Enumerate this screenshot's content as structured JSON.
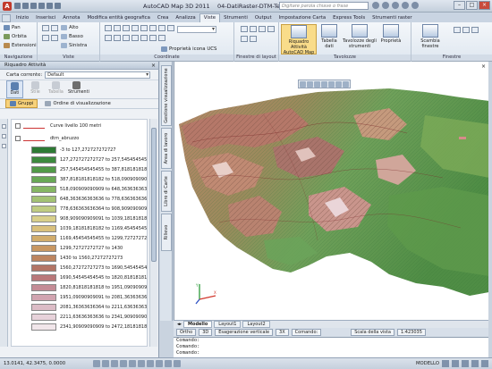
{
  "window": {
    "title": "AutoCAD Map 3D 2011",
    "document": "04-DatiRaster-DTM-Tema2-CurveLivello.dwg",
    "search_placeholder": "Digitare parola chiave o frase"
  },
  "ribbon_tabs": [
    "Inizio",
    "Inserisci",
    "Annota",
    "Modifica entità geografica",
    "Crea",
    "Analizza",
    "Viste",
    "Strumenti",
    "Output",
    "Impostazione Carta",
    "Express Tools",
    "Strumenti raster"
  ],
  "active_tab": "Viste",
  "ribbon": {
    "navigazione": {
      "title": "Navigazione",
      "items": [
        "Pan",
        "Orbita",
        "Estensioni"
      ]
    },
    "viste": {
      "title": "Viste",
      "items": [
        "Alto",
        "Basso",
        "Sinistra"
      ]
    },
    "coordinate": {
      "title": "Coordinate",
      "proprieta_ucs": "Proprietà icona UCS"
    },
    "finestre_layout": {
      "title": "Finestre di layout"
    },
    "tavolozze": {
      "title": "Tavolozze",
      "buttons": [
        "Riquadro Attività AutoCAD Map",
        "Tabella dati",
        "Tavolozze degli strumenti",
        "Proprietà"
      ]
    },
    "finestre": {
      "title": "Finestre",
      "buttons": [
        "Scambia finestre"
      ]
    }
  },
  "palette": {
    "title": "Riquadro Attività",
    "close": "×",
    "carta_label": "Carta corrente:",
    "carta_value": "Default",
    "modes": [
      "Dati",
      "Stile",
      "Tabella",
      "Strumenti"
    ],
    "subtabs": [
      "Gruppi",
      "Ordine di visualizzazione"
    ],
    "legend_rows": [
      {
        "label": "Curve livello 100 metri",
        "color": "#ffffff",
        "type": "layer"
      },
      {
        "label": "dtm_abruzzo",
        "color": "#ffffff",
        "type": "layer"
      },
      {
        "label": "-3 to 127,272727272727",
        "color": "#2e7a34"
      },
      {
        "label": "127,272727272727 to 257,545454545455",
        "color": "#3d8a3e"
      },
      {
        "label": "257,545454545455 to 387,818181818182",
        "color": "#529a48"
      },
      {
        "label": "387,818181818182 to 518,090909090909",
        "color": "#69a856"
      },
      {
        "label": "518,090909090909 to 648,363636363636",
        "color": "#86b664"
      },
      {
        "label": "648,363636363636 to 778,636363636364",
        "color": "#a3c274"
      },
      {
        "label": "778,636363636364 to 908,909090909091",
        "color": "#bfcc82"
      },
      {
        "label": "908,909090909091 to 1039,18181818182",
        "color": "#d8cf8b"
      },
      {
        "label": "1039,18181818182 to 1169,45454545455",
        "color": "#d9c07d"
      },
      {
        "label": "1169,45454545455 to 1299,72727272727",
        "color": "#d1ac6c"
      },
      {
        "label": "1299,72727272727 to 1430",
        "color": "#c89762"
      },
      {
        "label": "1430 to 1560,27272727273",
        "color": "#bd8560"
      },
      {
        "label": "1560,27272727273 to 1690,54545454545",
        "color": "#b37566"
      },
      {
        "label": "1690,54545454545 to 1820,81818181818",
        "color": "#b9787a"
      },
      {
        "label": "1820,81818181818 to 1951,09090909091",
        "color": "#c48c96"
      },
      {
        "label": "1951,09090909091 to 2081,36363636364",
        "color": "#d1a4b0"
      },
      {
        "label": "2081,36363636364 to 2211,63636363636",
        "color": "#dcbcc6"
      },
      {
        "label": "2211,63636363636 to 2341,90909090909",
        "color": "#e7d2da"
      },
      {
        "label": "2341,90909090909 to 2472,18181818182",
        "color": "#f1e6ea"
      }
    ]
  },
  "vertical_tabs": [
    "Gestione visualizzazione",
    "Area di lavoro",
    "Libro di Carte",
    "Rilievo"
  ],
  "layout_tabs": [
    "Modello",
    "Layout1",
    "Layout2"
  ],
  "tool_row": {
    "ortho": "Ortho",
    "mode3d": "3D",
    "esagerazione": "Esagerazione verticale",
    "esag_value": "3X",
    "comando": "Comando:",
    "scala_label": "Scala della vista",
    "scala_value": "1:423035"
  },
  "command_lines": [
    "Comando:",
    "Comando:",
    "Comando:"
  ],
  "status": {
    "coords": "13.0141, 42.3475, 0.0000",
    "modello": "MODELLO"
  }
}
